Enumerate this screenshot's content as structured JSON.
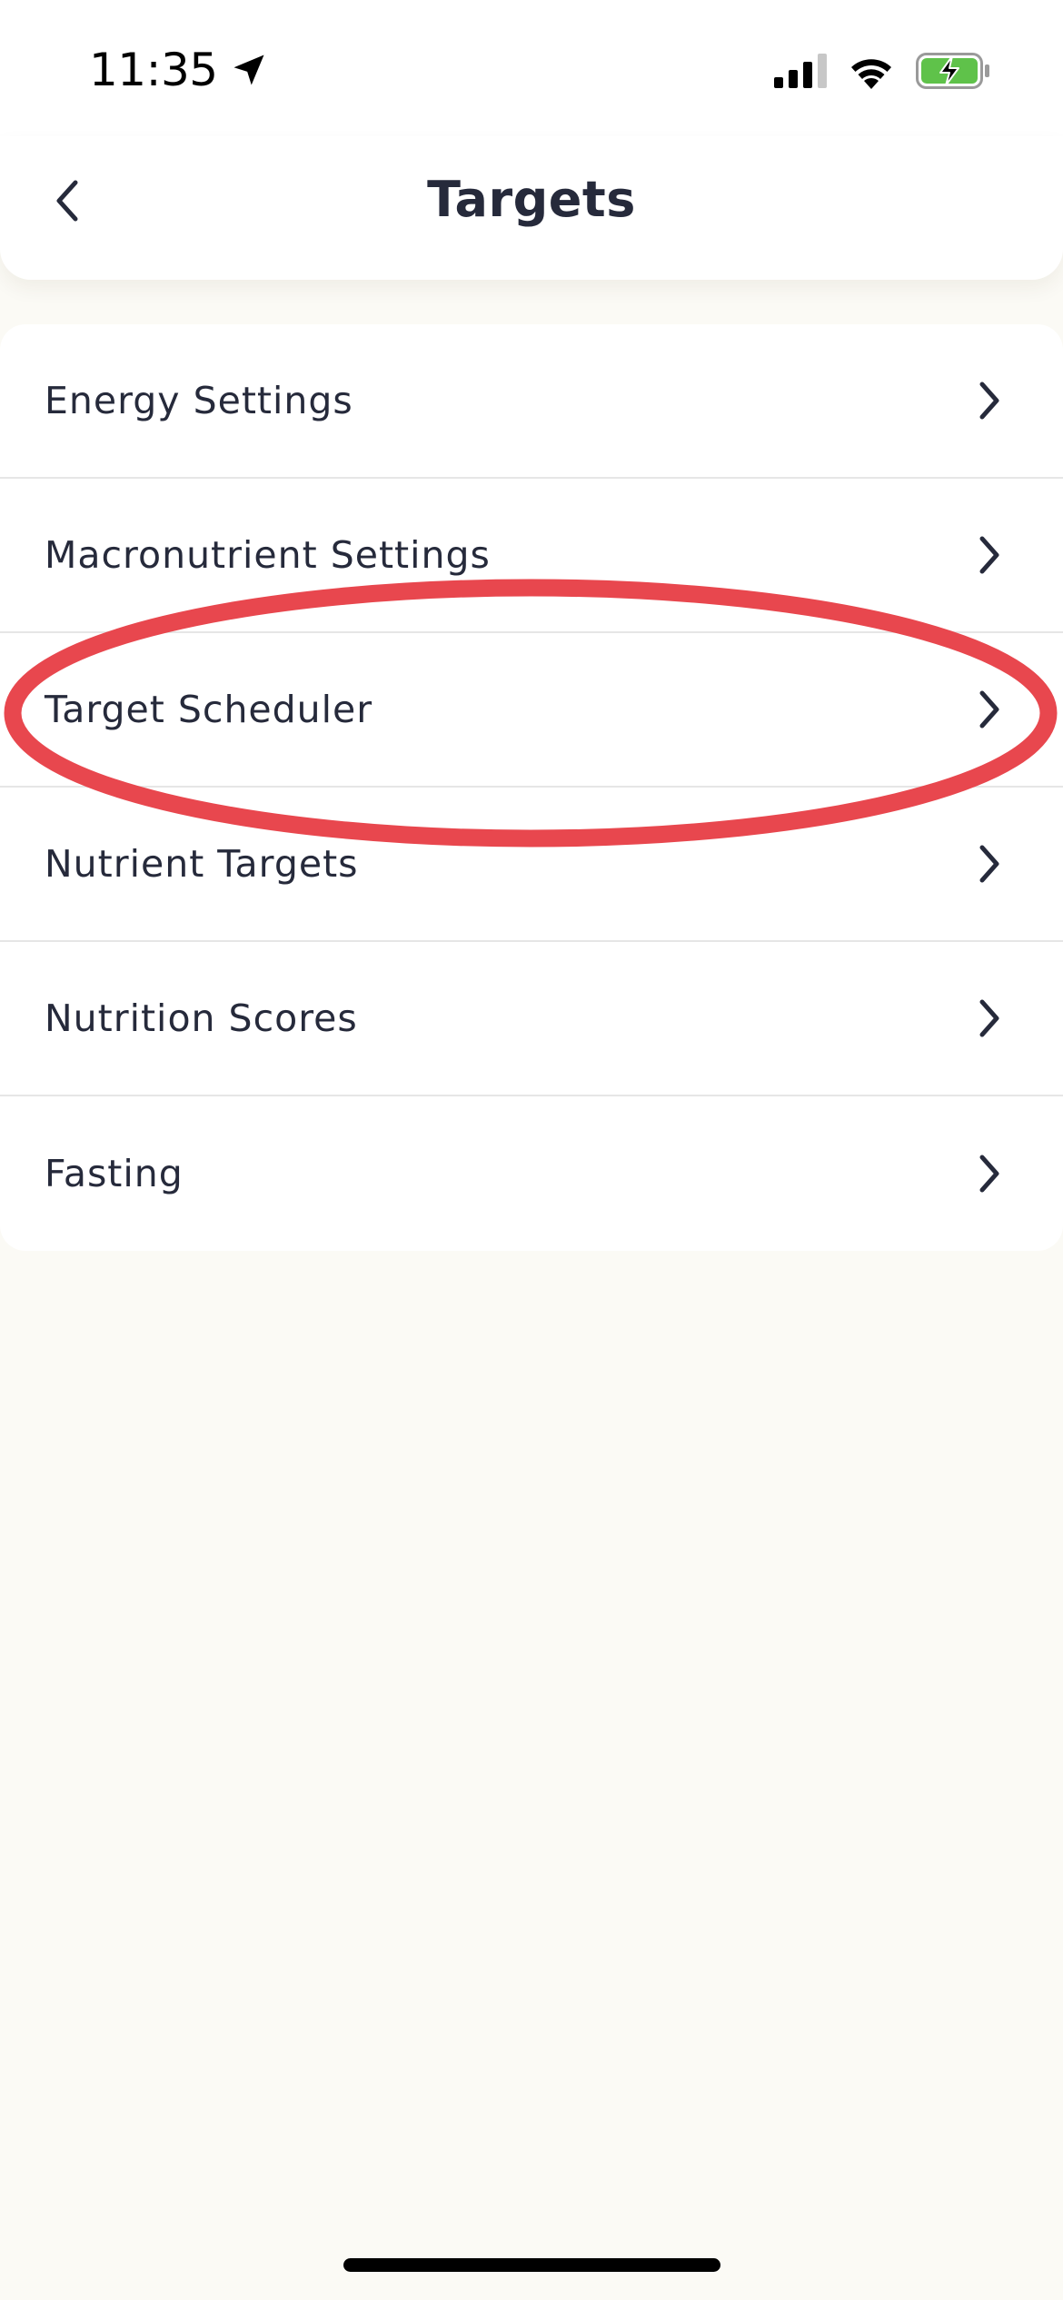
{
  "status_bar": {
    "time": "11:35",
    "icons": [
      "location-arrow-icon",
      "cellular-signal-icon",
      "wifi-icon",
      "battery-charging-icon"
    ],
    "battery_color": "#5fc24a"
  },
  "header": {
    "title": "Targets",
    "back_icon": "chevron-left-icon"
  },
  "settings": {
    "items": [
      {
        "label": "Energy Settings"
      },
      {
        "label": "Macronutrient Settings"
      },
      {
        "label": "Target Scheduler"
      },
      {
        "label": "Nutrient Targets"
      },
      {
        "label": "Nutrition Scores"
      },
      {
        "label": "Fasting"
      }
    ],
    "chevron_icon": "chevron-right-icon"
  },
  "annotation": {
    "shape": "ellipse",
    "highlighted_item": "Target Scheduler",
    "color": "#e8474e"
  },
  "theme": {
    "background": "#fbfaf5",
    "card": "#ffffff",
    "text": "#262a3b",
    "divider": "#e6e6e6"
  }
}
